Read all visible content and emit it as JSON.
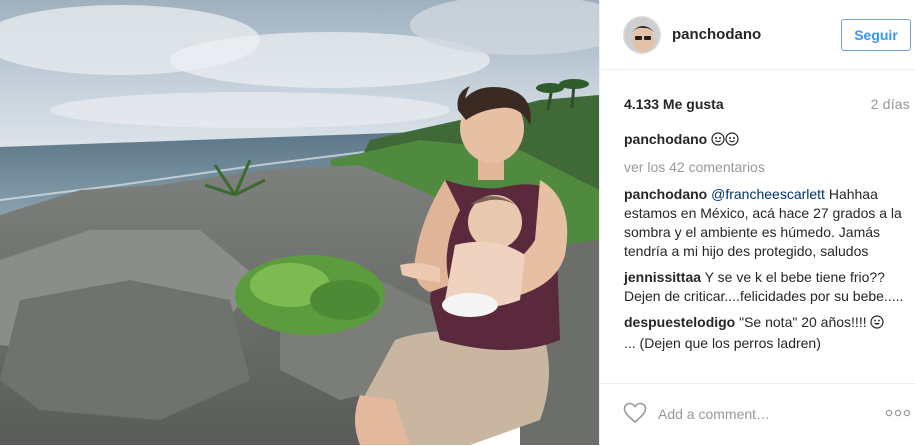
{
  "post": {
    "username": "panchodano",
    "follow_label": "Seguir",
    "likes": "4.133 Me gusta",
    "time_ago": "2 días",
    "caption_user": "panchodano",
    "view_all": "ver los 42 comentarios",
    "add_comment_placeholder": "Add a comment…"
  },
  "comments": [
    {
      "user": "panchodano",
      "mention": "@francheescarlett",
      "text": " Hahhaa estamos en México, acá hace 27 grados a la sombra y el ambiente es húmedo. Jamás tendría a mi hijo des protegido, saludos"
    },
    {
      "user": "jennissittaa",
      "mention": "",
      "text": " Y se ve k el bebe tiene frio?? Dejen de criticar....felicidades por su bebe....."
    },
    {
      "user": "despuestelodigo",
      "mention": "",
      "text": " \"Se nota\" 20 años!!!! ",
      "text2": "... (Dejen que los perros ladren)"
    }
  ],
  "icons": {
    "heart": "heart-icon",
    "more": "more-options-icon",
    "avatar": "avatar",
    "emoji": "smiling-face-icon"
  },
  "colors": {
    "follow_border": "#70a3d0",
    "follow_text": "#3897f0",
    "mention": "#003569",
    "muted": "#999999"
  }
}
